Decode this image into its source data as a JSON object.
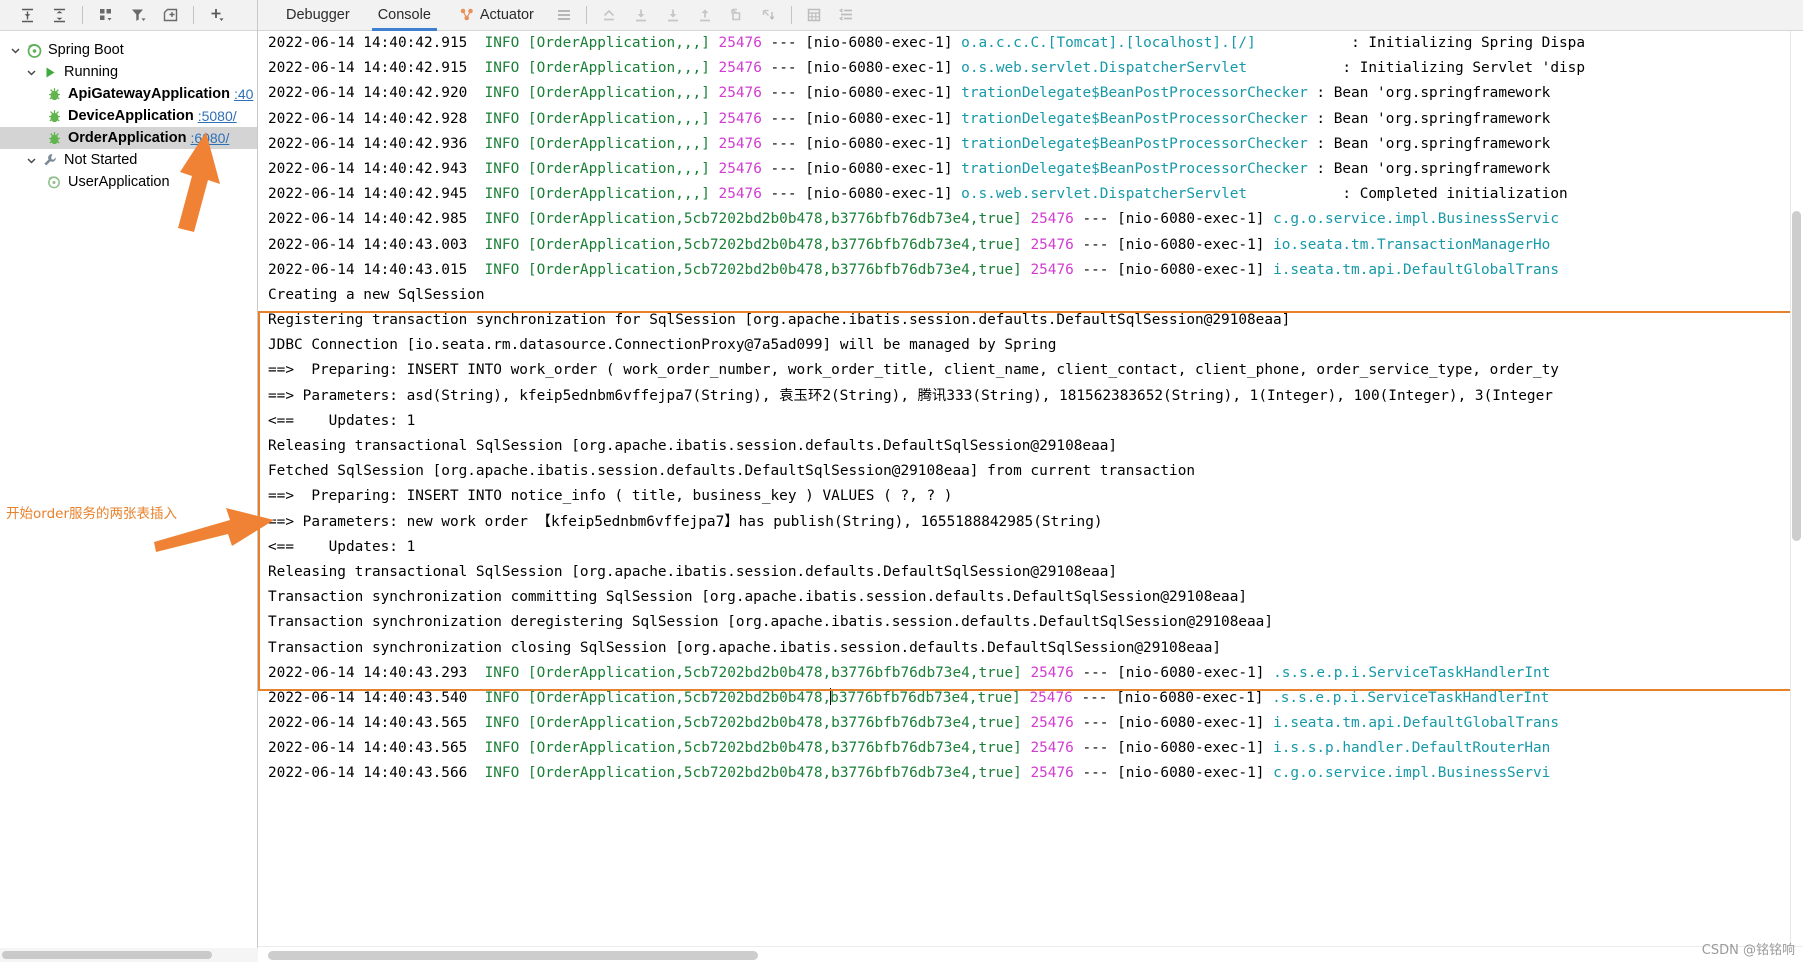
{
  "colors": {
    "accent_blue": "#3f7fd0",
    "annotation_orange": "#e8812b",
    "link_blue": "#2f6fb5",
    "level_green": "#1a7f37",
    "pid_magenta": "#d13cd1",
    "logger_teal": "#1799a8"
  },
  "left_toolbar": {
    "buttons": [
      {
        "name": "expand-all-icon",
        "title": "Expand All"
      },
      {
        "name": "collapse-all-icon",
        "title": "Collapse All"
      },
      {
        "name": "group-by-icon",
        "title": "Group By"
      },
      {
        "name": "filter-icon",
        "title": "Filter"
      },
      {
        "name": "add-frame-icon",
        "title": "Add Frame"
      },
      {
        "name": "add-icon",
        "title": "Add Configuration"
      }
    ]
  },
  "tree": {
    "root": {
      "label": "Spring Boot",
      "icon": "spring-boot-icon",
      "expanded": true
    },
    "groups": [
      {
        "label": "Running",
        "icon": "run-triangle-icon",
        "expanded": true,
        "items": [
          {
            "label": "ApiGatewayApplication",
            "port": ":40",
            "selected": false,
            "icon": "spring-bean-icon"
          },
          {
            "label": "DeviceApplication",
            "port": ":5080/",
            "selected": false,
            "icon": "spring-bean-icon"
          },
          {
            "label": "OrderApplication",
            "port": ":6080/",
            "selected": true,
            "icon": "spring-bean-icon"
          }
        ]
      },
      {
        "label": "Not Started",
        "icon": "wrench-icon",
        "expanded": true,
        "items": [
          {
            "label": "UserApplication",
            "port": "",
            "selected": false,
            "icon": "spring-boot-icon"
          }
        ]
      }
    ]
  },
  "annotation": {
    "text": "开始order服务的两张表插入"
  },
  "console_toolbar": {
    "tabs": [
      {
        "label": "Debugger",
        "active": false,
        "icon": ""
      },
      {
        "label": "Console",
        "active": true,
        "icon": ""
      },
      {
        "label": "Actuator",
        "active": false,
        "icon": "actuator-icon"
      }
    ],
    "buttons": [
      {
        "name": "layout-menu-icon",
        "title": "Layout Settings"
      },
      {
        "name": "step-out-icon",
        "title": "Step Out"
      },
      {
        "name": "step-over-icon",
        "title": "Step Over"
      },
      {
        "name": "step-into-icon",
        "title": "Step Into"
      },
      {
        "name": "force-step-into-icon",
        "title": "Force Step Into"
      },
      {
        "name": "run-to-cursor-icon",
        "title": "Run To Cursor"
      },
      {
        "name": "drop-frame-icon",
        "title": "Drop Frame"
      },
      {
        "name": "evaluate-table-icon",
        "title": "Evaluate Expression"
      },
      {
        "name": "soft-wrap-icon",
        "title": "Soft-Wrap"
      }
    ]
  },
  "watermark": "CSDN @铭铭响",
  "console_lines": [
    {
      "type": "log",
      "ts": "2022-06-14 14:40:42.915",
      "level": "INFO",
      "app": "[OrderApplication,,,]",
      "pid": "25476",
      "thread": "[nio-6080-exec-1]",
      "logger": "o.a.c.c.C.[Tomcat].[localhost].[/]",
      "pad": 11,
      "msg": ": Initializing Spring Dispa"
    },
    {
      "type": "log",
      "ts": "2022-06-14 14:40:42.915",
      "level": "INFO",
      "app": "[OrderApplication,,,]",
      "pid": "25476",
      "thread": "[nio-6080-exec-1]",
      "logger": "o.s.web.servlet.DispatcherServlet",
      "pad": 11,
      "msg": ": Initializing Servlet 'disp"
    },
    {
      "type": "log",
      "ts": "2022-06-14 14:40:42.920",
      "level": "INFO",
      "app": "[OrderApplication,,,]",
      "pid": "25476",
      "thread": "[nio-6080-exec-1]",
      "logger": "trationDelegate$BeanPostProcessorChecker",
      "pad": 1,
      "msg": ": Bean 'org.springframework"
    },
    {
      "type": "log",
      "ts": "2022-06-14 14:40:42.928",
      "level": "INFO",
      "app": "[OrderApplication,,,]",
      "pid": "25476",
      "thread": "[nio-6080-exec-1]",
      "logger": "trationDelegate$BeanPostProcessorChecker",
      "pad": 1,
      "msg": ": Bean 'org.springframework"
    },
    {
      "type": "log",
      "ts": "2022-06-14 14:40:42.936",
      "level": "INFO",
      "app": "[OrderApplication,,,]",
      "pid": "25476",
      "thread": "[nio-6080-exec-1]",
      "logger": "trationDelegate$BeanPostProcessorChecker",
      "pad": 1,
      "msg": ": Bean 'org.springframework"
    },
    {
      "type": "log",
      "ts": "2022-06-14 14:40:42.943",
      "level": "INFO",
      "app": "[OrderApplication,,,]",
      "pid": "25476",
      "thread": "[nio-6080-exec-1]",
      "logger": "trationDelegate$BeanPostProcessorChecker",
      "pad": 1,
      "msg": ": Bean 'org.springframework"
    },
    {
      "type": "log",
      "ts": "2022-06-14 14:40:42.945",
      "level": "INFO",
      "app": "[OrderApplication,,,]",
      "pid": "25476",
      "thread": "[nio-6080-exec-1]",
      "logger": "o.s.web.servlet.DispatcherServlet",
      "pad": 11,
      "msg": ": Completed initialization "
    },
    {
      "type": "log",
      "ts": "2022-06-14 14:40:42.985",
      "level": "INFO",
      "app": "[OrderApplication,5cb7202bd2b0b478,b3776bfb76db73e4,true]",
      "pid": "25476",
      "thread": "[nio-6080-exec-1]",
      "logger": "c.g.o.service.impl.BusinessServic",
      "pad": 0,
      "msg": ""
    },
    {
      "type": "log",
      "ts": "2022-06-14 14:40:43.003",
      "level": "INFO",
      "app": "[OrderApplication,5cb7202bd2b0b478,b3776bfb76db73e4,true]",
      "pid": "25476",
      "thread": "[nio-6080-exec-1]",
      "logger": "io.seata.tm.TransactionManagerHo",
      "pad": 0,
      "msg": ""
    },
    {
      "type": "log",
      "ts": "2022-06-14 14:40:43.015",
      "level": "INFO",
      "app": "[OrderApplication,5cb7202bd2b0b478,b3776bfb76db73e4,true]",
      "pid": "25476",
      "thread": "[nio-6080-exec-1]",
      "logger": "i.seata.tm.api.DefaultGlobalTrans",
      "pad": 0,
      "msg": ""
    },
    {
      "type": "plain",
      "text": "Creating a new SqlSession"
    },
    {
      "type": "plain",
      "text": "Registering transaction synchronization for SqlSession [org.apache.ibatis.session.defaults.DefaultSqlSession@29108eaa]"
    },
    {
      "type": "plain",
      "text": "JDBC Connection [io.seata.rm.datasource.ConnectionProxy@7a5ad099] will be managed by Spring"
    },
    {
      "type": "plain",
      "text": "==>  Preparing: INSERT INTO work_order ( work_order_number, work_order_title, client_name, client_contact, client_phone, order_service_type, order_ty"
    },
    {
      "type": "plain",
      "text": "==> Parameters: asd(String), kfeip5ednbm6vffejpa7(String), 袁玉环2(String), 腾讯333(String), 181562383652(String), 1(Integer), 100(Integer), 3(Integer"
    },
    {
      "type": "plain",
      "text": "<==    Updates: 1"
    },
    {
      "type": "plain",
      "text": "Releasing transactional SqlSession [org.apache.ibatis.session.defaults.DefaultSqlSession@29108eaa]"
    },
    {
      "type": "plain",
      "text": "Fetched SqlSession [org.apache.ibatis.session.defaults.DefaultSqlSession@29108eaa] from current transaction"
    },
    {
      "type": "plain",
      "text": "==>  Preparing: INSERT INTO notice_info ( title, business_key ) VALUES ( ?, ? )"
    },
    {
      "type": "plain",
      "text": "==> Parameters: new work order 【kfeip5ednbm6vffejpa7】has publish(String), 1655188842985(String)"
    },
    {
      "type": "plain",
      "text": "<==    Updates: 1"
    },
    {
      "type": "plain",
      "text": "Releasing transactional SqlSession [org.apache.ibatis.session.defaults.DefaultSqlSession@29108eaa]"
    },
    {
      "type": "plain",
      "text": "Transaction synchronization committing SqlSession [org.apache.ibatis.session.defaults.DefaultSqlSession@29108eaa]"
    },
    {
      "type": "plain",
      "text": "Transaction synchronization deregistering SqlSession [org.apache.ibatis.session.defaults.DefaultSqlSession@29108eaa]"
    },
    {
      "type": "plain",
      "text": "Transaction synchronization closing SqlSession [org.apache.ibatis.session.defaults.DefaultSqlSession@29108eaa]"
    },
    {
      "type": "log",
      "ts": "2022-06-14 14:40:43.293",
      "level": "INFO",
      "app": "[OrderApplication,5cb7202bd2b0b478,b3776bfb76db73e4,true]",
      "pid": "25476",
      "thread": "[nio-6080-exec-1]",
      "logger": ".s.s.e.p.i.ServiceTaskHandlerInt",
      "pad": 0,
      "msg": ""
    },
    {
      "type": "log",
      "ts": "2022-06-14 14:40:43.540",
      "level": "INFO",
      "app": "[OrderApplication,5cb7202bd2b0b478,b3776bfb76db73e4,true]",
      "pid": "25476",
      "thread": "[nio-6080-exec-1]",
      "logger": ".s.s.e.p.i.ServiceTaskHandlerInt",
      "pad": 0,
      "msg": "",
      "caret_at": 40
    },
    {
      "type": "log",
      "ts": "2022-06-14 14:40:43.565",
      "level": "INFO",
      "app": "[OrderApplication,5cb7202bd2b0b478,b3776bfb76db73e4,true]",
      "pid": "25476",
      "thread": "[nio-6080-exec-1]",
      "logger": "i.seata.tm.api.DefaultGlobalTrans",
      "pad": 0,
      "msg": ""
    },
    {
      "type": "log",
      "ts": "2022-06-14 14:40:43.565",
      "level": "INFO",
      "app": "[OrderApplication,5cb7202bd2b0b478,b3776bfb76db73e4,true]",
      "pid": "25476",
      "thread": "[nio-6080-exec-1]",
      "logger": "i.s.s.p.handler.DefaultRouterHan",
      "pad": 0,
      "msg": ""
    },
    {
      "type": "log",
      "ts": "2022-06-14 14:40:43.566",
      "level": "INFO",
      "app": "[OrderApplication,5cb7202bd2b0b478,b3776bfb76db73e4,true]",
      "pid": "25476",
      "thread": "[nio-6080-exec-1]",
      "logger": "c.g.o.service.impl.BusinessServi",
      "pad": 0,
      "msg": ""
    }
  ]
}
